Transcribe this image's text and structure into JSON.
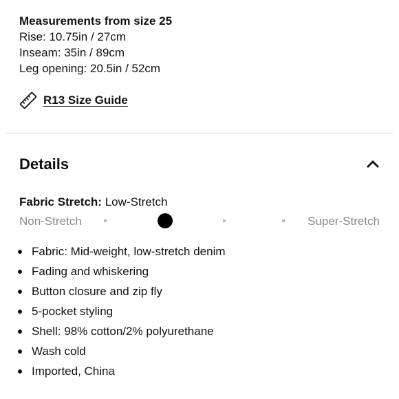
{
  "measurements": {
    "heading": "Measurements from size 25",
    "lines": [
      "Rise: 10.75in / 27cm",
      "Inseam: 35in / 89cm",
      "Leg opening: 20.5in / 52cm"
    ]
  },
  "size_guide": {
    "icon": "ruler-icon",
    "label": "R13 Size Guide"
  },
  "details": {
    "title": "Details",
    "toggle_icon": "chevron-up-icon",
    "fabric_stretch": {
      "key": "Fabric Stretch:",
      "value": "Low-Stretch",
      "scale_min_label": "Non-Stretch",
      "scale_max_label": "Super-Stretch",
      "scale_steps": 4,
      "selected_step": 1
    },
    "bullets": [
      "Fabric: Mid-weight, low-stretch denim",
      "Fading and whiskering",
      "Button closure and zip fly",
      "5-pocket styling",
      "Shell: 98% cotton/2% polyurethane",
      "Wash cold",
      "Imported, China"
    ]
  }
}
